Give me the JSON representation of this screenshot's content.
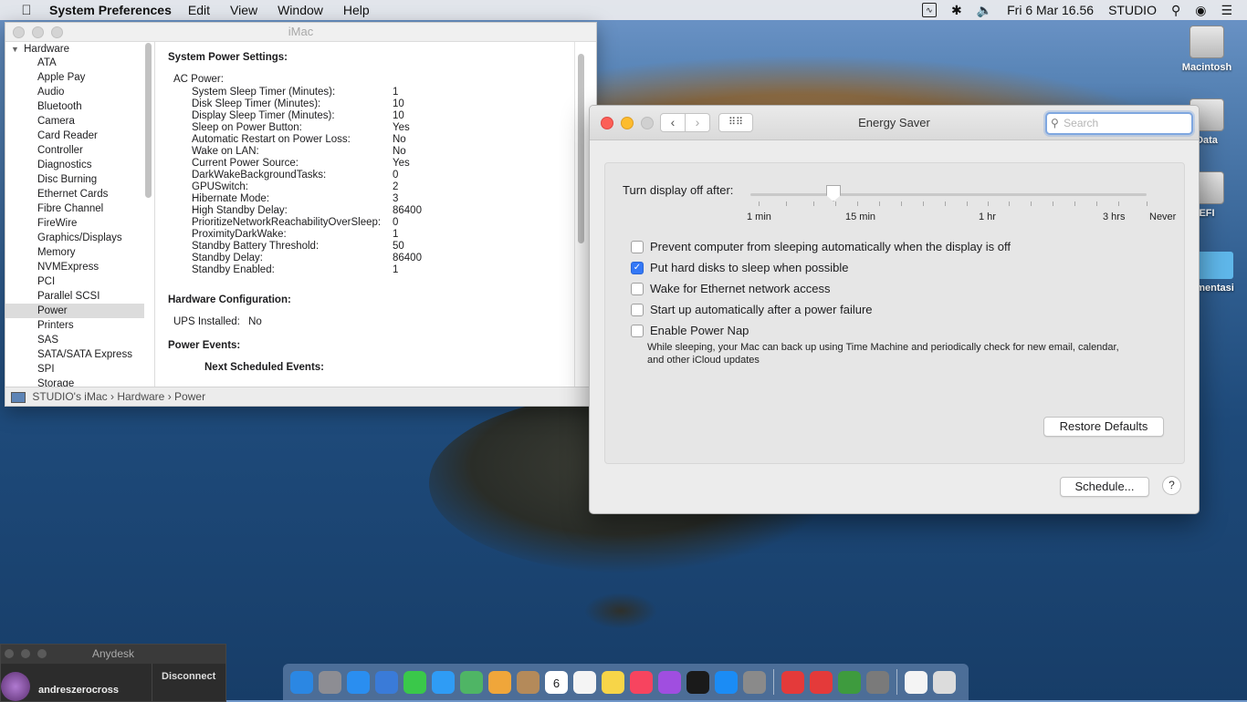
{
  "menubar": {
    "app_name": "System Preferences",
    "items": [
      "Edit",
      "View",
      "Window",
      "Help"
    ],
    "datetime": "Fri 6 Mar  16.56",
    "user": "STUDIO"
  },
  "desktop": {
    "icons": [
      {
        "label": "Macintosh"
      },
      {
        "label": "Data"
      },
      {
        "label": "EFI"
      },
      {
        "label": "mentasi"
      }
    ]
  },
  "sysinfo": {
    "window_title": "iMac",
    "sidebar_group": "Hardware",
    "sidebar_items": [
      "ATA",
      "Apple Pay",
      "Audio",
      "Bluetooth",
      "Camera",
      "Card Reader",
      "Controller",
      "Diagnostics",
      "Disc Burning",
      "Ethernet Cards",
      "Fibre Channel",
      "FireWire",
      "Graphics/Displays",
      "Memory",
      "NVMExpress",
      "PCI",
      "Parallel SCSI",
      "Power",
      "Printers",
      "SAS",
      "SATA/SATA Express",
      "SPI",
      "Storage"
    ],
    "selected_item": "Power",
    "section_power_settings": "System Power Settings:",
    "ac_power_label": "AC Power:",
    "ac_power": [
      {
        "k": "System Sleep Timer (Minutes):",
        "v": "1"
      },
      {
        "k": "Disk Sleep Timer (Minutes):",
        "v": "10"
      },
      {
        "k": "Display Sleep Timer (Minutes):",
        "v": "10"
      },
      {
        "k": "Sleep on Power Button:",
        "v": "Yes"
      },
      {
        "k": "Automatic Restart on Power Loss:",
        "v": "No"
      },
      {
        "k": "Wake on LAN:",
        "v": "No"
      },
      {
        "k": "Current Power Source:",
        "v": "Yes"
      },
      {
        "k": "DarkWakeBackgroundTasks:",
        "v": "0"
      },
      {
        "k": "GPUSwitch:",
        "v": "2"
      },
      {
        "k": "Hibernate Mode:",
        "v": "3"
      },
      {
        "k": "High Standby Delay:",
        "v": "86400"
      },
      {
        "k": "PrioritizeNetworkReachabilityOverSleep:",
        "v": "0"
      },
      {
        "k": "ProximityDarkWake:",
        "v": "1"
      },
      {
        "k": "Standby Battery Threshold:",
        "v": "50"
      },
      {
        "k": "Standby Delay:",
        "v": "86400"
      },
      {
        "k": "Standby Enabled:",
        "v": "1"
      }
    ],
    "section_hw_config": "Hardware Configuration:",
    "ups_label": "UPS Installed:",
    "ups_value": "No",
    "section_power_events": "Power Events:",
    "next_events": "Next Scheduled Events:",
    "breadcrumb": {
      "root": "STUDIO's iMac",
      "sep1": "›",
      "mid": "Hardware",
      "sep2": "›",
      "leaf": "Power"
    }
  },
  "energy": {
    "window_title": "Energy Saver",
    "search_placeholder": "Search",
    "slider_label": "Turn display off after:",
    "slider_value_minutes": 10,
    "tick_labels": [
      "1 min",
      "15 min",
      "1 hr",
      "3 hrs",
      "Never"
    ],
    "options": [
      {
        "label": "Prevent computer from sleeping automatically when the display is off",
        "checked": false
      },
      {
        "label": "Put hard disks to sleep when possible",
        "checked": true
      },
      {
        "label": "Wake for Ethernet network access",
        "checked": false
      },
      {
        "label": "Start up automatically after a power failure",
        "checked": false
      },
      {
        "label": "Enable Power Nap",
        "checked": false
      }
    ],
    "power_nap_desc": "While sleeping, your Mac can back up using Time Machine and periodically check for new email, calendar, and other iCloud updates",
    "restore_label": "Restore Defaults",
    "schedule_label": "Schedule...",
    "help_label": "?"
  },
  "anydesk": {
    "title": "Anydesk",
    "user": "andreszerocross",
    "disconnect": "Disconnect"
  },
  "dock": {
    "apps": [
      "finder-icon",
      "launchpad-icon",
      "safari-icon",
      "mail-icon",
      "facetime-icon",
      "messages-icon",
      "maps-icon",
      "photos-icon",
      "contacts-icon",
      "calendar-icon",
      "reminders-icon",
      "notes-icon",
      "music-icon",
      "podcasts-icon",
      "tv-icon",
      "appstore-icon",
      "systemprefs-icon",
      "anydesk-icon",
      "anydesk2-icon",
      "gpu-icon",
      "usb-icon",
      "document-icon",
      "trash-icon"
    ],
    "calendar_day": "6",
    "colors": [
      "#2b87e3",
      "#8d8d93",
      "#2a8ef0",
      "#3a7bd8",
      "#3ac84a",
      "#2f9cf5",
      "#4fb565",
      "#f0a63a",
      "#b48a5a",
      "#ffffff",
      "#f4f4f4",
      "#f7d548",
      "#f7445f",
      "#a04ee0",
      "#1a1a1a",
      "#1b8cf5",
      "#8a8a8a",
      "#e43a3a",
      "#e43a3a",
      "#3e9b3e",
      "#7a7a7a",
      "#f4f4f4",
      "#dcdcdc"
    ]
  }
}
